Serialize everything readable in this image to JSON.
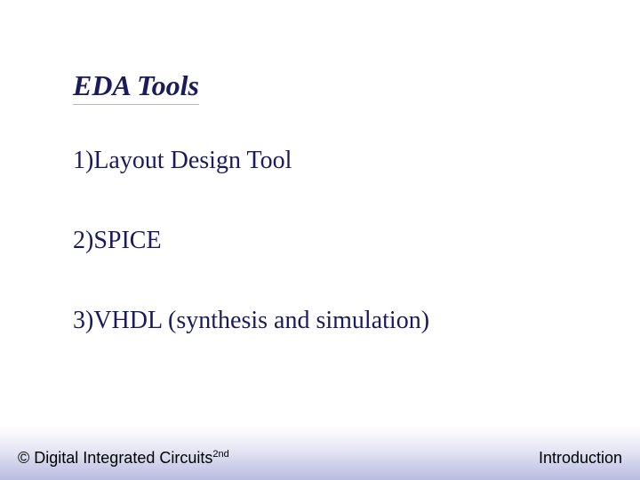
{
  "title": "EDA Tools",
  "items": [
    "1)Layout Design Tool",
    "2)SPICE",
    "3)VHDL (synthesis and simulation)"
  ],
  "footer": {
    "left_main": "© Digital Integrated Circuits",
    "left_sup": "2nd",
    "right": "Introduction"
  }
}
